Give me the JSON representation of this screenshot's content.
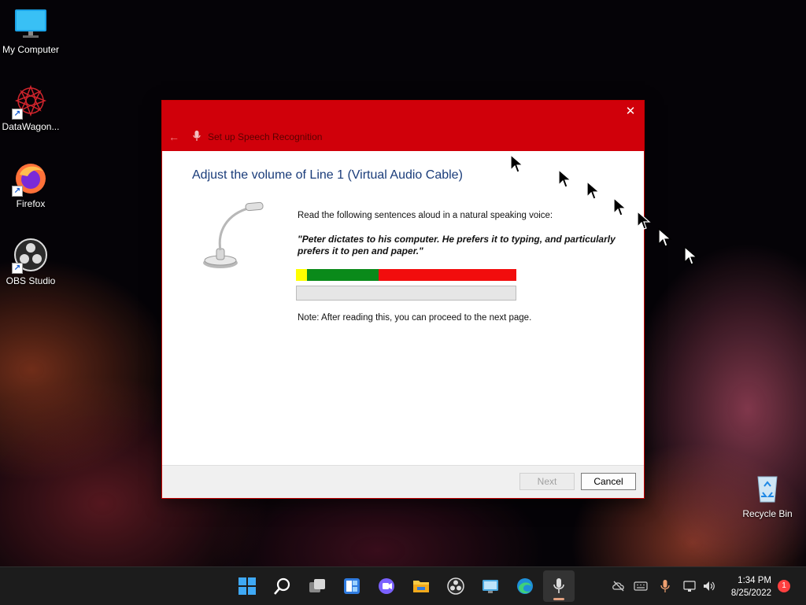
{
  "desktop": {
    "icons": [
      {
        "label": "My Computer",
        "icon": "monitor-icon"
      },
      {
        "label": "DataWagon...",
        "icon": "datawagon-icon"
      },
      {
        "label": "Firefox",
        "icon": "firefox-icon"
      },
      {
        "label": "OBS Studio",
        "icon": "obs-icon"
      },
      {
        "label": "Recycle Bin",
        "icon": "recycle-bin-icon"
      }
    ]
  },
  "dialog": {
    "title": "Set up Speech Recognition",
    "heading": "Adjust the volume of Line 1 (Virtual Audio Cable)",
    "instruction": "Read the following sentences aloud in a natural speaking voice:",
    "quote": "\"Peter dictates to his computer. He prefers it to typing, and particularly prefers it to pen and paper.\"",
    "note": "Note: After reading this, you can proceed to the next page.",
    "progress": 0,
    "buttons": {
      "next": "Next",
      "cancel": "Cancel"
    },
    "colors": {
      "titlebar": "#d0000a",
      "meter_yellow": "#ffff00",
      "meter_green": "#0a8a1a",
      "meter_red": "#f20d0d"
    }
  },
  "taskbar": {
    "apps": [
      "windows-start-icon",
      "search-icon",
      "task-view-icon",
      "widgets-icon",
      "teams-chat-icon",
      "file-explorer-icon",
      "obs-icon",
      "remote-desktop-icon",
      "edge-icon",
      "speech-recognition-icon"
    ],
    "tray": [
      "cloud-offline-icon",
      "keyboard-icon",
      "microphone-icon",
      "network-icon",
      "volume-icon"
    ],
    "time": "1:34 PM",
    "date": "8/25/2022",
    "notification_count": "1"
  }
}
